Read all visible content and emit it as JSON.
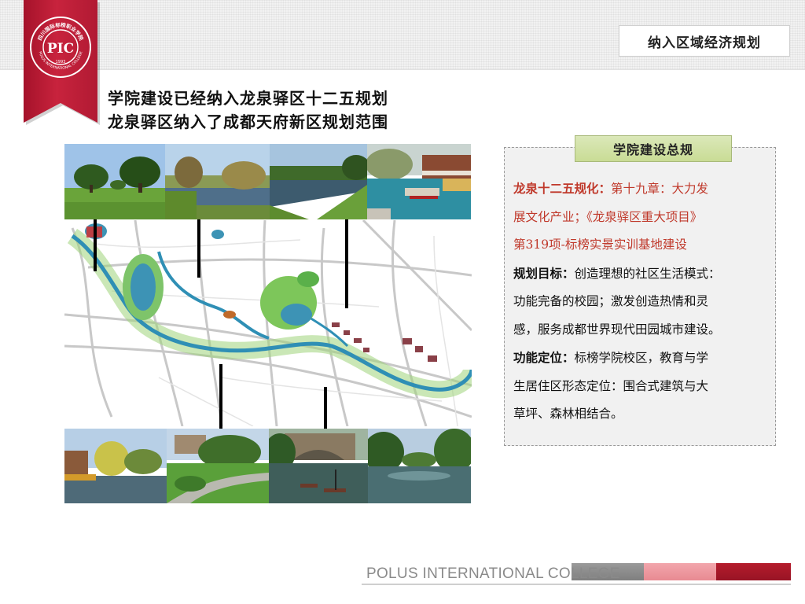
{
  "header": {
    "section_title": "纳入区域经济规划",
    "logo": {
      "name_cn": "四川国际标榜职业学院",
      "name_en": "POLUS INTERNATIONAL COLLEGE",
      "year": "1993",
      "monogram": "PIC"
    }
  },
  "headline": {
    "line1": "学院建设已经纳入龙泉驿区十二五规划",
    "line2": "龙泉驿区纳入了成都天府新区规划范围"
  },
  "panel": {
    "tab_label": "学院建设总规",
    "paragraphs": [
      "龙泉十二五规化：第十九章：大力发展文化产业；《龙泉驿区重大项目》第319项-标榜实景实训基地建设",
      "规划目标：创造理想的社区生活模式：功能完备的校园；激发创造热情和灵感，服务成都世界现代田园城市建设。",
      "功能定位：标榜学院校区，教育与学生居住区形态定位：围合式建筑与大草坪、森林相结合。"
    ],
    "lines": [
      "龙泉十二五规化：第十九章：大力发",
      "展文化产业；《龙泉驿区重大项目》",
      "第319项-标榜实景实训基地建设",
      "规划目标：创造理想的社区生活模式：",
      "功能完备的校园；激发创造热情和灵",
      "感，服务成都世界现代田园城市建设。",
      "功能定位：标榜学院校区，教育与学",
      "生居住区形态定位：围合式建筑与大",
      "草坪、森林相结合。"
    ]
  },
  "footer": {
    "college_name": "POLUS INTERNATIONAL COLLEGE"
  },
  "colors": {
    "ribbon_red": "#b51c2c",
    "panel_tab_green": "#c9dc95",
    "highlight_red_text": "#c0392b",
    "footer_gray": "#8c8c8c",
    "footer_pink": "#ee959c",
    "footer_red": "#a8182a"
  }
}
